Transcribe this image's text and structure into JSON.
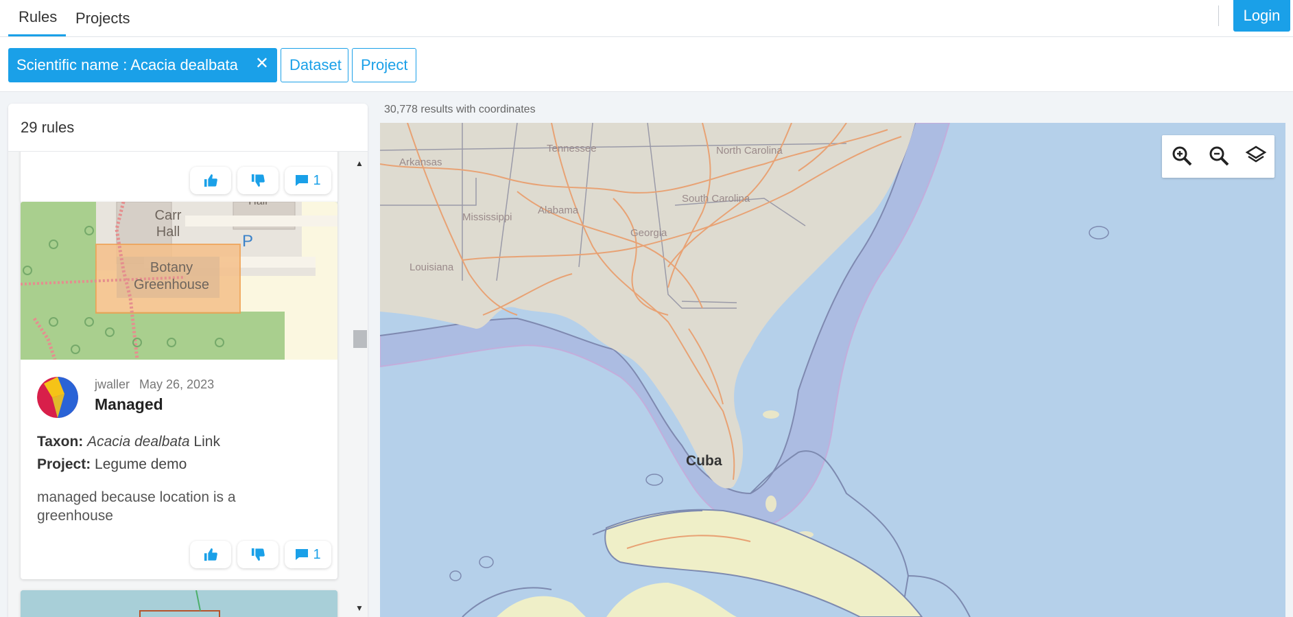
{
  "nav": {
    "tabs": [
      {
        "label": "Rules",
        "active": true
      },
      {
        "label": "Projects",
        "active": false
      }
    ],
    "login_label": "Login"
  },
  "filters": {
    "active_chip": "Scientific name : Acacia dealbata",
    "remove_icon": "close-icon",
    "options": [
      "Dataset",
      "Project"
    ]
  },
  "rules_panel": {
    "count_label": "29 rules",
    "cards": [
      {
        "comment_count": "1"
      },
      {
        "map_labels": [
          "Carr\nHall",
          "Botany\nGreenhouse",
          "P",
          "Hall"
        ],
        "user": "jwaller",
        "date": "May 26, 2023",
        "title": "Managed",
        "taxon_label": "Taxon:",
        "taxon_value": "Acacia dealbata",
        "taxon_link": "Link",
        "project_label": "Project:",
        "project_value": "Legume demo",
        "description": "managed because location is a greenhouse",
        "comment_count": "1"
      }
    ]
  },
  "map": {
    "result_count": "30,778 results with coordinates",
    "labels": [
      "Tennessee",
      "North Carolina",
      "Arkansas",
      "South Carolina",
      "Mississippi",
      "Alabama",
      "Georgia",
      "Louisiana",
      "Cuba"
    ],
    "controls": [
      "zoom-in-icon",
      "zoom-out-icon",
      "layers-icon"
    ],
    "colors": {
      "water": "#b5d0ea",
      "land": "#dedbd0",
      "roads": "#e8a274",
      "accent": "#1aa0e8"
    }
  }
}
